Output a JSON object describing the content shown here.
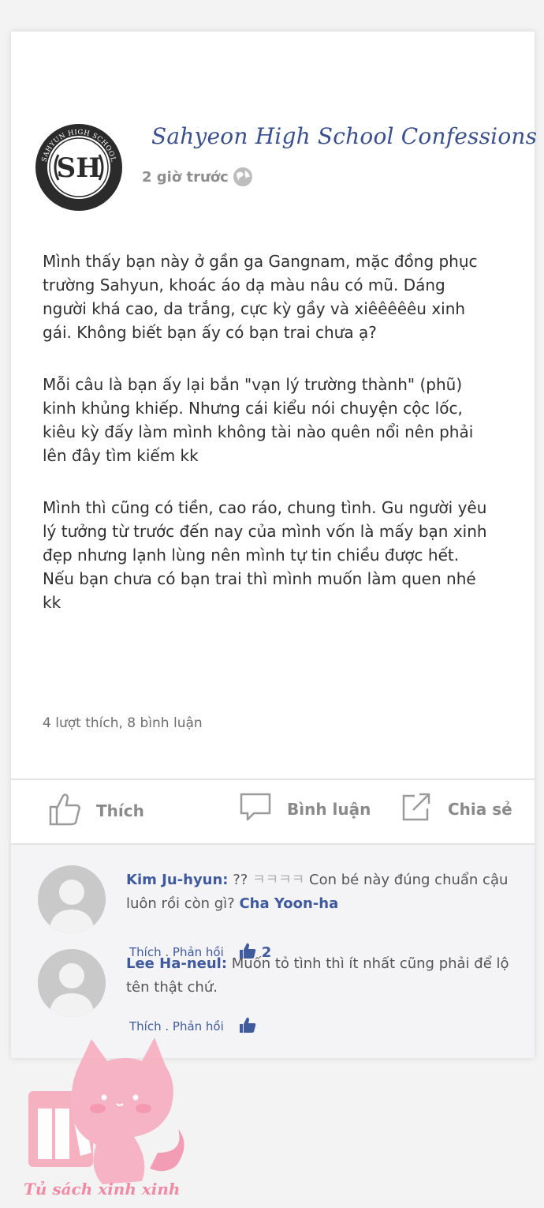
{
  "post": {
    "logo": {
      "ring_text": "SAHYUN HIGH SCHOOL",
      "monogram": "SH",
      "bottom_text": "SEOUL·1906"
    },
    "page_name": "Sahyeon High School Confessions",
    "time": "2 giờ trước",
    "time_icon": "globe-icon",
    "paragraphs": [
      "Mình thấy bạn này ở gần ga Gangnam, mặc đồng phục trường Sahyun, khoác áo dạ màu nâu có mũ. Dáng người khá cao, da trắng, cực kỳ gầy và xiêêêêêu xinh gái. Không biết bạn ấy có bạn trai chưa ạ?",
      "Mỗi câu là bạn ấy lại bắn \"vạn lý trường thành\" (phũ) kinh khủng khiếp. Nhưng cái kiểu nói chuyện cộc lốc, kiêu kỳ đấy làm mình không tài nào quên nổi nên phải lên đây tìm kiếm kk",
      "Mình thì cũng có tiền, cao ráo, chung tình. Gu người yêu lý tưởng từ trước đến nay của mình vốn là mấy bạn xinh đẹp nhưng lạnh lùng nên mình tự tin chiều được hết. Nếu bạn chưa có bạn trai thì mình muốn làm quen nhé kk"
    ],
    "reaction_summary": "4 lượt thích, 8 bình luận"
  },
  "actions": {
    "like": "Thích",
    "comment": "Bình luận",
    "share": "Chia sẻ"
  },
  "comments": [
    {
      "author": "Kim Ju-hyun:",
      "text_before": "?? ",
      "laugh": "ㅋㅋㅋㅋ",
      "text_after": " Con bé này đúng chuẩn cậu luôn rồi còn gì? ",
      "tag": "Cha Yoon-ha",
      "actions": "Thích . Phản hồi",
      "likes": "2"
    },
    {
      "author": "Lee Ha-neul:",
      "text": " Muốn tỏ tình thì ít nhất cũng phải để lộ tên thật chứ.",
      "actions": "Thích . Phản hồi"
    }
  ],
  "watermark": {
    "brand": "Tủ sách xinh xinh"
  },
  "colors": {
    "accent": "#3f5a9d",
    "title": "#3a4f8e",
    "watermark": "#f08aa4"
  }
}
